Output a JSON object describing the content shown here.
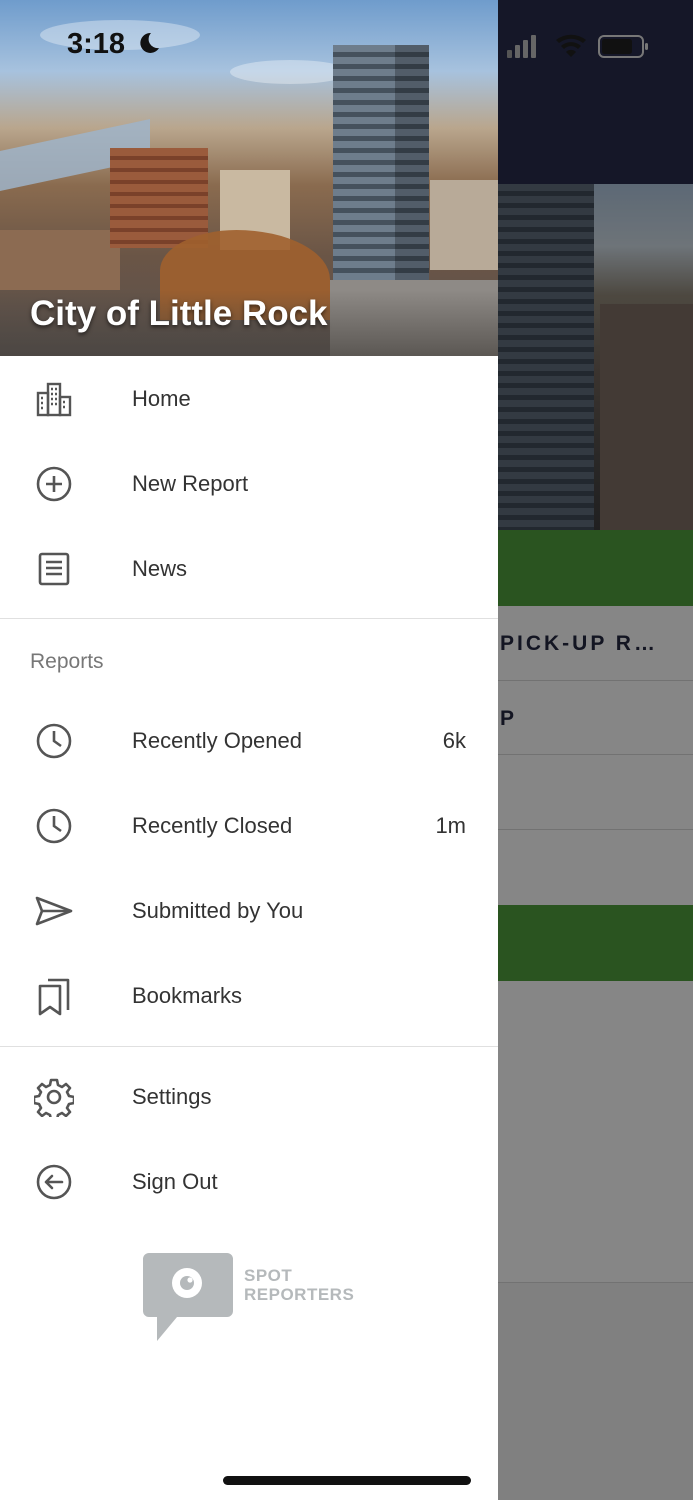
{
  "status_bar": {
    "time": "3:18",
    "icons": [
      "moon-icon",
      "cellular-signal-icon",
      "wifi-icon",
      "battery-icon"
    ]
  },
  "drawer": {
    "header_title": "City of Little Rock",
    "primary_items": [
      {
        "label": "Home",
        "icon": "city-buildings-icon"
      },
      {
        "label": "New Report",
        "icon": "plus-circle-icon"
      },
      {
        "label": "News",
        "icon": "news-icon"
      }
    ],
    "reports_section_label": "Reports",
    "report_items": [
      {
        "label": "Recently Opened",
        "icon": "clock-icon",
        "count": "6k"
      },
      {
        "label": "Recently Closed",
        "icon": "clock-icon",
        "count": "1m"
      },
      {
        "label": "Submitted by You",
        "icon": "send-icon"
      },
      {
        "label": "Bookmarks",
        "icon": "bookmarks-icon"
      }
    ],
    "bottom_items": [
      {
        "label": "Settings",
        "icon": "gear-icon"
      },
      {
        "label": "Sign Out",
        "icon": "arrow-left-circle-icon"
      }
    ],
    "brand": {
      "line1": "SPOT",
      "line2": "REPORTERS",
      "icon": "spot-reporters-logo"
    }
  },
  "background": {
    "row1_text": "PICK-UP R…",
    "row2_text": "P"
  },
  "colors": {
    "header_navy": "#272a49",
    "accent_green": "#4d9a3b",
    "icon_gray": "#555555",
    "text_dark": "#333333",
    "section_gray": "#777777",
    "brand_gray": "#b5b9bb"
  }
}
